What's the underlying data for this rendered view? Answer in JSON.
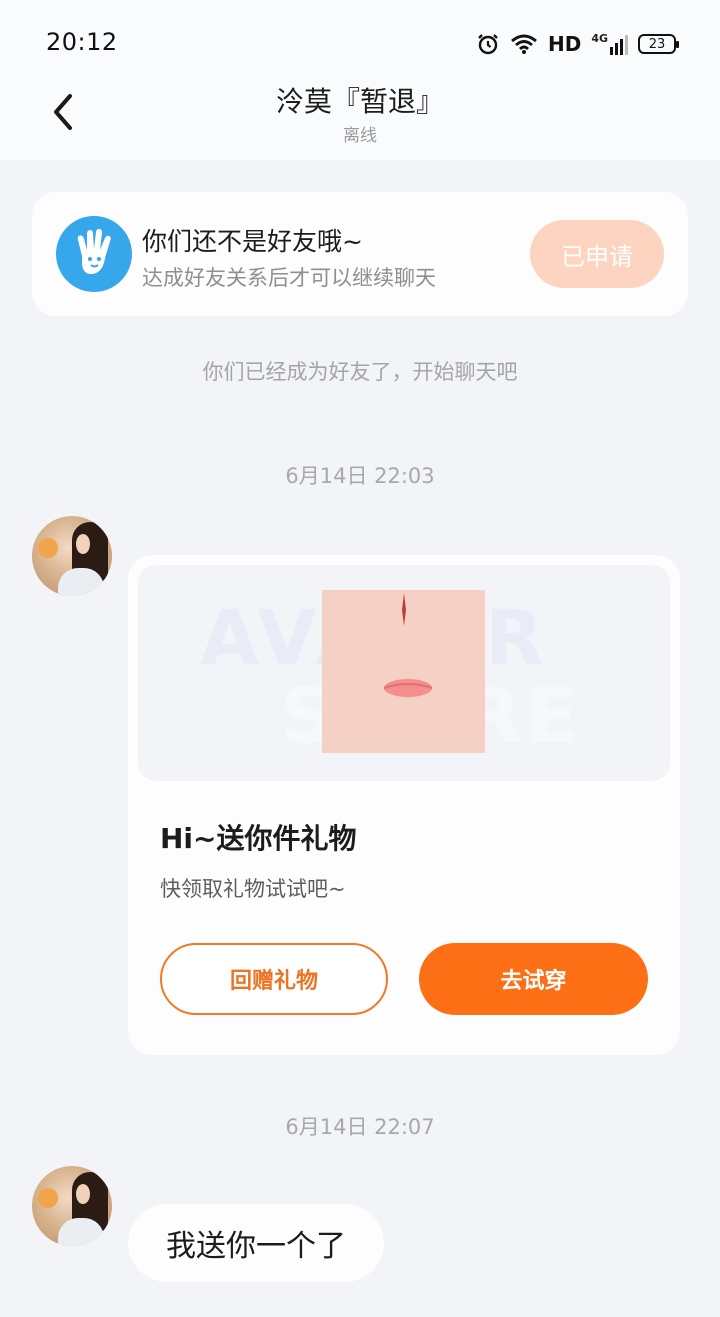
{
  "status_bar": {
    "time": "20:12",
    "network_label": "HD",
    "signal_label": "4G",
    "battery": "23"
  },
  "header": {
    "title": "泠莫『暂退』",
    "subtitle": "离线"
  },
  "friend_banner": {
    "title": "你们还不是好友哦~",
    "subtitle": "达成好友关系后才可以继续聊天",
    "button_label": "已申请"
  },
  "messages": {
    "system_notice": "你们已经成为好友了，开始聊天吧",
    "timestamp_1": "6月14日 22:03",
    "gift": {
      "watermark_line1": "AVATAR",
      "watermark_line2": "STORE",
      "title": "Hi~送你件礼物",
      "subtitle": "快领取礼物试试吧~",
      "return_gift_label": "回赠礼物",
      "try_on_label": "去试穿"
    },
    "timestamp_2": "6月14日 22:07",
    "text_message": "我送你一个了"
  },
  "colors": {
    "accent": "#fc6f14",
    "applied_button": "#fdd4c0",
    "hand_icon_bg": "#35a7ea",
    "background": "#f3f4f8"
  }
}
